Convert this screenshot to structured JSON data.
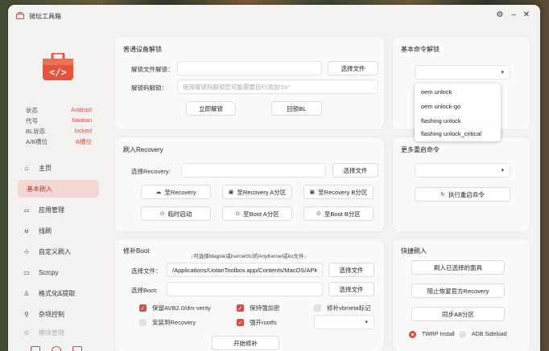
{
  "window": {
    "title": "骑坛工具箱"
  },
  "colors": {
    "accent": "#e04a3f",
    "active_nav_bg": "#f3d7d5"
  },
  "window_controls": {
    "settings": "⚙",
    "minimize": "–",
    "close": "✕"
  },
  "sidebar": {
    "device_info": [
      {
        "key": "状态",
        "value": "Android"
      },
      {
        "key": "代号",
        "value": "haotian"
      },
      {
        "key": "BL状态",
        "value": "locked"
      },
      {
        "key": "A/B槽位",
        "value": "B槽位"
      }
    ],
    "nav": [
      {
        "label": "主页",
        "icon": "home-icon"
      },
      {
        "label": "基本刷入",
        "icon": "flash-icon",
        "active": true
      },
      {
        "label": "应用管理",
        "icon": "apps-icon"
      },
      {
        "label": "线刷",
        "icon": "cable-icon"
      },
      {
        "label": "自定义刷入",
        "icon": "custom-icon"
      },
      {
        "label": "Scrcpy",
        "icon": "screen-icon"
      },
      {
        "label": "格式化&提取",
        "icon": "format-icon"
      },
      {
        "label": "杂项控制",
        "icon": "misc-icon"
      },
      {
        "label": "模块管理",
        "icon": "module-icon"
      }
    ]
  },
  "unlock": {
    "title": "普通设备解锁",
    "file_label": "解锁文件解锁：",
    "file_value": "",
    "choose_file": "选择文件",
    "code_label": "解锁码解锁：",
    "code_placeholder": "使用解锁码解锁您可能需要自行添加\"0x\"",
    "unlock_now": "立即解锁",
    "relock": "回锁BL"
  },
  "basic_cmd": {
    "title": "基本命令解锁",
    "selected": "",
    "options": [
      "oem unlock",
      "oem unlock-go",
      "flashing unlock",
      "flashing unlock_critical"
    ]
  },
  "recovery": {
    "title": "刷入Recovery",
    "select_label": "选择Recovery:",
    "value": "",
    "choose_file": "选择文件",
    "to_recovery": "至Recovery",
    "to_recovery_a": "至Recovery A分区",
    "to_recovery_b": "至Recovery B分区",
    "temp_boot": "临时启动",
    "to_boot_a": "至Boot A分区",
    "to_boot_b": "至Boot B分区"
  },
  "reboot": {
    "title": "更多重启命令",
    "selected": "",
    "execute": "执行重启命令"
  },
  "patch": {
    "title": "修补Boot",
    "hint": "↓可选择Magisk或KernelSU的AnyKernel或ko文件↓",
    "file_label": "选择文件：",
    "file_value": "/Applications/UotanToolbox.app/Contents/MacOS/APK/Magisk",
    "choose_file": "选择文件",
    "boot_label": "选择Boot:",
    "boot_value": "",
    "choose_file2": "选择文件",
    "options": [
      {
        "label": "保留AVB2.0/dm-verity",
        "checked": true
      },
      {
        "label": "保持强加密",
        "checked": true
      },
      {
        "label": "修补vbmeta标记",
        "checked": false
      },
      {
        "label": "安装到Recovery",
        "checked": false
      },
      {
        "label": "强开rootfs",
        "checked": true
      }
    ],
    "start": "开始修补"
  },
  "quick_flash": {
    "title": "快捷刷入",
    "flash_selected": "刷入已选择的面具",
    "block_recovery": "阻止恢复官方Recovery",
    "sync_ab": "同步AB分区",
    "modes": [
      {
        "label": "TWRP Install",
        "selected": true
      },
      {
        "label": "ADB Sideload",
        "selected": false
      }
    ]
  }
}
